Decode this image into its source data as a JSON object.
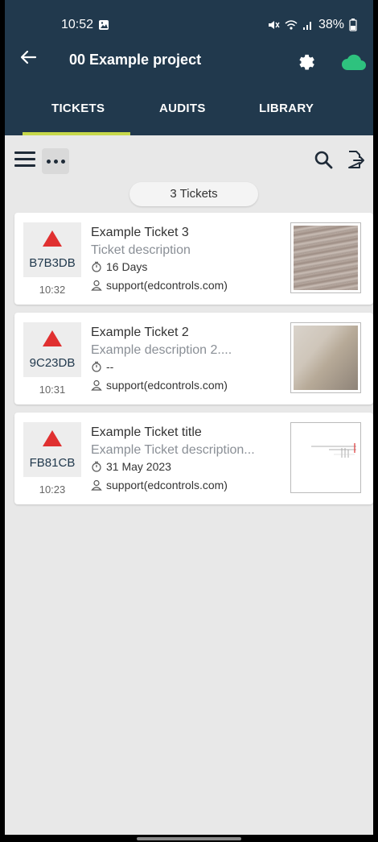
{
  "status_bar": {
    "time": "10:52",
    "battery": "38%"
  },
  "app_bar": {
    "title": "00 Example project"
  },
  "tabs": [
    {
      "label": "TICKETS",
      "active": true
    },
    {
      "label": "AUDITS",
      "active": false
    },
    {
      "label": "LIBRARY",
      "active": false
    }
  ],
  "list_header": {
    "count_label": "3 Tickets"
  },
  "tickets": [
    {
      "code": "B7B3DB",
      "time": "10:32",
      "title": "Example Ticket 3",
      "description": "Ticket description",
      "due": "16 Days",
      "user": "support(edcontrols.com)",
      "priority_color": "#e03030"
    },
    {
      "code": "9C23DB",
      "time": "10:31",
      "title": "Example Ticket 2",
      "description": "Example description 2....",
      "due": "--",
      "user": "support(edcontrols.com)",
      "priority_color": "#e03030"
    },
    {
      "code": "FB81CB",
      "time": "10:23",
      "title": "Example Ticket title",
      "description": "Example Ticket description...",
      "due": "31 May 2023",
      "user": "support(edcontrols.com)",
      "priority_color": "#e03030"
    }
  ],
  "colors": {
    "header": "#21394d",
    "tab_indicator": "#c7d84a",
    "cloud": "#2ec27e",
    "priority": "#e03030"
  },
  "icons": [
    "back-arrow-icon",
    "gear-icon",
    "cloud-sync-icon",
    "hamburger-menu-icon",
    "more-dots-icon",
    "search-icon",
    "export-icon",
    "timer-icon",
    "user-icon"
  ]
}
